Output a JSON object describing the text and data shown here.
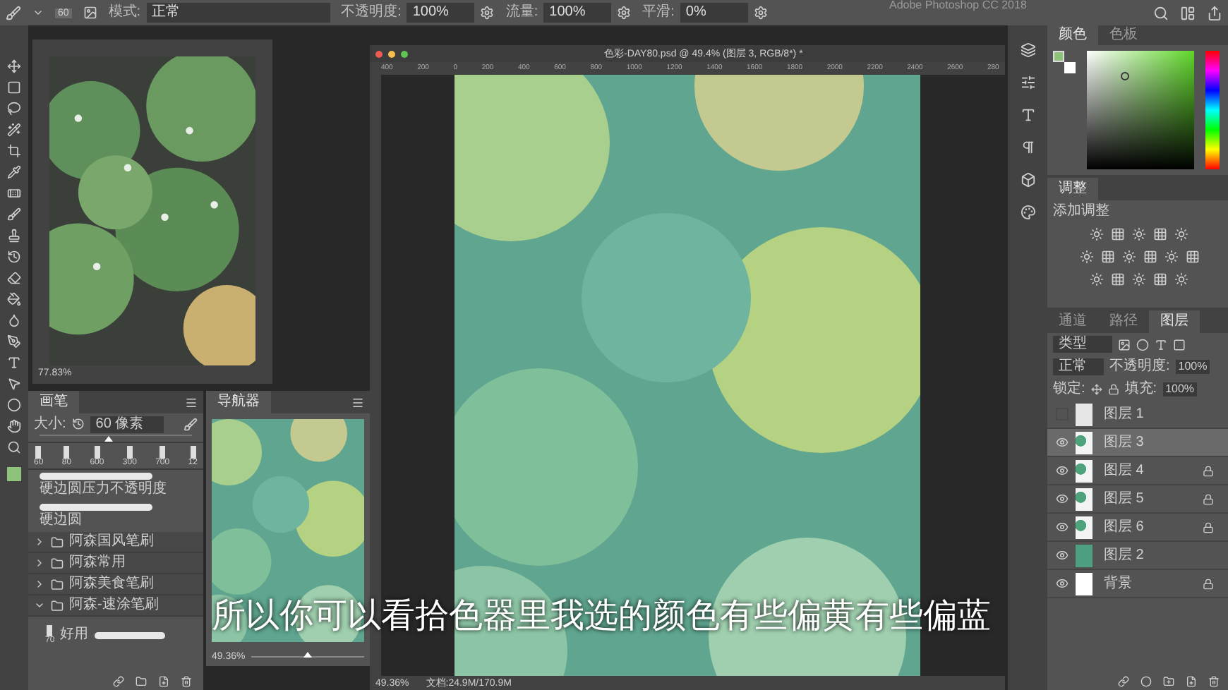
{
  "app_title": "Adobe Photoshop CC 2018",
  "options_bar": {
    "brush_size": "60",
    "fields": [
      {
        "label": "模式:",
        "value": "正常"
      },
      {
        "label": "不透明度:",
        "value": "100%"
      },
      {
        "label": "流量:",
        "value": "100%"
      },
      {
        "label": "平滑:",
        "value": "0%"
      }
    ]
  },
  "reference_window": {
    "zoom": "77.83%"
  },
  "brush_panel": {
    "tab": "画笔",
    "size_label": "大小:",
    "size_value": "60 像素",
    "level": 0.45,
    "presets": [
      "60",
      "80",
      "600",
      "300",
      "700",
      "12"
    ],
    "strokes": [
      "硬边圆压力不透明度",
      "硬边圆"
    ],
    "groups": [
      {
        "name": "阿森国风笔刷",
        "expanded": false
      },
      {
        "name": "阿森常用",
        "expanded": false
      },
      {
        "name": "阿森美食笔刷",
        "expanded": false
      },
      {
        "name": "阿森-速涂笔刷",
        "expanded": true
      }
    ],
    "brush": {
      "size": "70",
      "name": "好用"
    }
  },
  "navigator": {
    "tab": "导航器",
    "zoom": "49.36%",
    "level": 0.5
  },
  "document": {
    "title": "色彩-DAY80.psd @ 49.4% (图层 3, RGB/8*) *",
    "ruler": [
      "400",
      "200",
      "0",
      "200",
      "400",
      "600",
      "800",
      "1000",
      "1200",
      "1400",
      "1600",
      "1800",
      "2000",
      "2200",
      "2400",
      "2600",
      "280"
    ],
    "zoom": "49.36%",
    "doc_size": "文档:24.9M/170.9M"
  },
  "color_panel": {
    "tabs": [
      {
        "label": "颜色",
        "selected": true
      },
      {
        "label": "色板",
        "selected": false
      }
    ],
    "swatches": [
      {
        "kind": "foreground",
        "color": "#8fc27a"
      },
      {
        "kind": "background",
        "color": "#ffffff"
      }
    ]
  },
  "adjustments": {
    "tab": "调整",
    "title": "添加调整"
  },
  "layers_panel": {
    "tabs": [
      {
        "label": "通道",
        "selected": false
      },
      {
        "label": "路径",
        "selected": false
      },
      {
        "label": "图层",
        "selected": true
      }
    ],
    "filter": "类型",
    "blend": "正常",
    "opacity_label": "不透明度:",
    "opacity": "100%",
    "lock_label": "锁定:",
    "fill_label": "填充:",
    "fill": "100%",
    "layers": [
      {
        "name": "图层 1",
        "visible": false,
        "selected": false,
        "locked": false,
        "kind": "transparent"
      },
      {
        "name": "图层 3",
        "visible": true,
        "selected": true,
        "locked": false,
        "kind": "spots"
      },
      {
        "name": "图层 4",
        "visible": true,
        "selected": false,
        "locked": true,
        "kind": "spots"
      },
      {
        "name": "图层 5",
        "visible": true,
        "selected": false,
        "locked": true,
        "kind": "spots"
      },
      {
        "name": "图层 6",
        "visible": true,
        "selected": false,
        "locked": true,
        "kind": "spots"
      },
      {
        "name": "图层 2",
        "visible": true,
        "selected": false,
        "locked": false,
        "kind": "green"
      },
      {
        "name": "背景",
        "visible": true,
        "selected": false,
        "locked": true,
        "kind": "white"
      }
    ]
  },
  "subtitle": "所以你可以看拾色器里我选的颜色有些偏黄有些偏蓝"
}
